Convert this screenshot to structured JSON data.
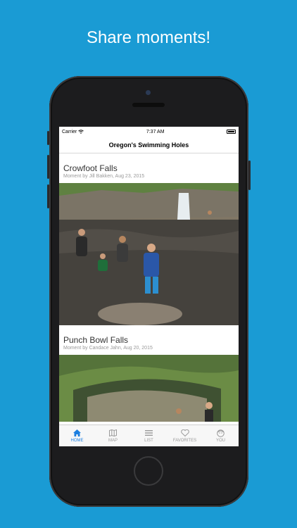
{
  "headline": "Share moments!",
  "status_bar": {
    "carrier": "Carrier",
    "time": "7:37 AM"
  },
  "app": {
    "title": "Oregon's Swimming Holes"
  },
  "moments": [
    {
      "title": "Crowfoot Falls",
      "meta": "Moment by Jill Bakken, Aug 23, 2015"
    },
    {
      "title": "Punch Bowl Falls",
      "meta": "Moment by Candace Jahn, Aug 20, 2015"
    }
  ],
  "tabs": [
    {
      "label": "HOME",
      "icon": "home-icon",
      "active": true
    },
    {
      "label": "MAP",
      "icon": "map-icon",
      "active": false
    },
    {
      "label": "LIST",
      "icon": "list-icon",
      "active": false
    },
    {
      "label": "FAVORITES",
      "icon": "heart-icon",
      "active": false
    },
    {
      "label": "YOU",
      "icon": "face-icon",
      "active": false
    }
  ],
  "colors": {
    "background": "#1a9bd4",
    "tab_active": "#1d7fe0",
    "tab_inactive": "#9a9a9a"
  }
}
